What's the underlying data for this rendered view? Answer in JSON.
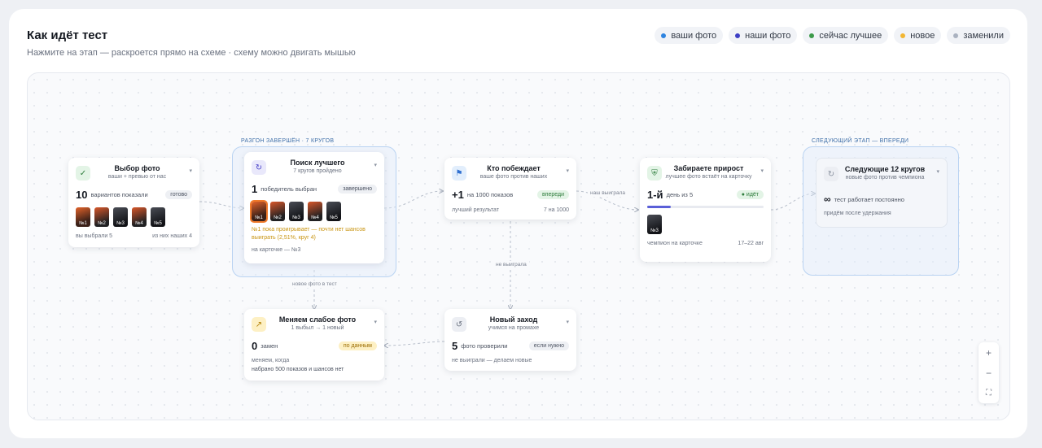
{
  "header": {
    "title": "Как идёт тест",
    "subtitle": "Нажмите на этап — раскроется прямо на схеме · схему можно двигать мышью"
  },
  "legend": [
    {
      "label": "ваши фото",
      "color": "#2f84e0"
    },
    {
      "label": "наши фото",
      "color": "#3d3fc4"
    },
    {
      "label": "сейчас лучшее",
      "color": "#3c9a4a"
    },
    {
      "label": "новое",
      "color": "#f2b632"
    },
    {
      "label": "заменили",
      "color": "#aab2c0"
    }
  ],
  "groups": {
    "boost": "РАЗГОН ЗАВЕРШЁН · 7 КРУГОВ",
    "next": "СЛЕДУЮЩИЙ ЭТАП — ВПЕРЕДИ"
  },
  "nodes": {
    "select": {
      "title": "Выбор фото",
      "sub": "ваши + превью от нас",
      "big": "10",
      "label": "вариантов показали",
      "tag": "готово",
      "thumbs": [
        "№1",
        "№2",
        "№3",
        "№4",
        "№5"
      ],
      "foot_left": "вы выбрали 5",
      "foot_right": "из них наших 4"
    },
    "search": {
      "title": "Поиск лучшего",
      "sub": "7 кругов пройдено",
      "big": "1",
      "label": "победитель выбран",
      "tag": "завершено",
      "thumbs": [
        "№1",
        "№2",
        "№3",
        "№4",
        "№5"
      ],
      "warn": "№1 пока проигрывает — почти нет шансов выиграть (2,51%, круг 4)",
      "note": "на карточке — №3"
    },
    "winner": {
      "title": "Кто побеждает",
      "sub": "ваше фото против наших",
      "big": "+1",
      "label": "на 1000 показов",
      "tag": "впереди",
      "foot_left": "лучший результат",
      "foot_right": "7 на 1000"
    },
    "gain": {
      "title": "Забираете прирост",
      "sub": "лучшее фото встаёт на карточку",
      "big": "1-й",
      "label": "день из 5",
      "tag": "идёт",
      "progress": 0.2,
      "thumb": "№3",
      "foot_left": "чемпион на карточке",
      "foot_right": "17–22 авг"
    },
    "next": {
      "title": "Следующие 12 кругов",
      "sub": "новые фото против чемпиона",
      "inf": "тест работает постоянно",
      "note": "придём после удержания"
    },
    "swap": {
      "title": "Меняем слабое фото",
      "sub": "1 выбыл → 1 новый",
      "big": "0",
      "label": "замен",
      "tag": "по данным",
      "note1": "меняем, когда",
      "note2": "набрано 500 показов и шансов нет"
    },
    "retry": {
      "title": "Новый заход",
      "sub": "учимся на промахе",
      "big": "5",
      "label": "фото проверили",
      "tag": "если нужно",
      "note": "не выиграли — делаем новые"
    }
  },
  "edges": {
    "our_won": "наш выиграла",
    "not_won": "не выиграла",
    "new_photo": "новое фото в тест"
  },
  "zoom": {
    "in": "+",
    "out": "−",
    "fit": "⛶"
  }
}
